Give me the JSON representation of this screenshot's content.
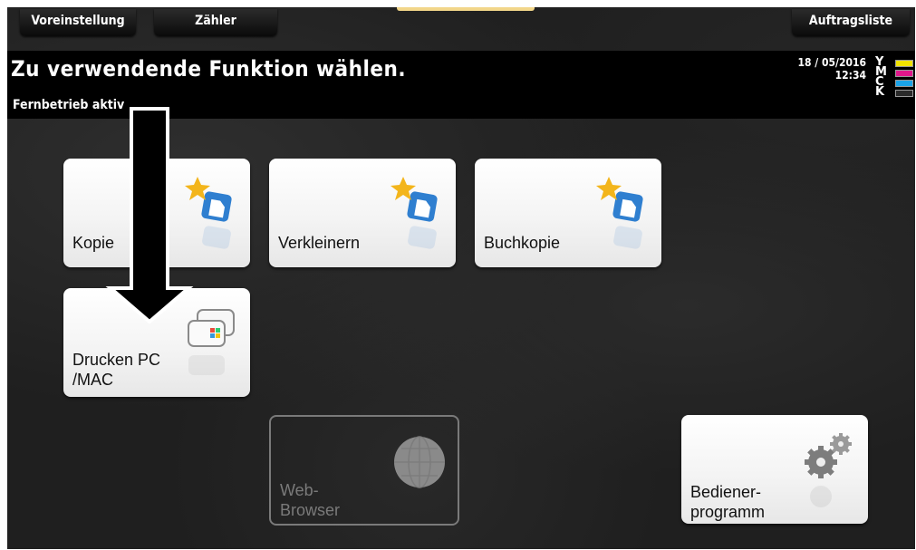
{
  "topbar": {
    "preset_label": "Voreinstellung",
    "counter_label": "Zähler",
    "joblist_label": "Auftragsliste"
  },
  "header": {
    "title": "Zu verwendende Funktion wählen.",
    "status": "Fernbetrieb aktiv",
    "date": "18 / 05/2016",
    "time": "12:34"
  },
  "toner": [
    {
      "letter": "Y",
      "color": "#f1e300"
    },
    {
      "letter": "M",
      "color": "#e0178b"
    },
    {
      "letter": "C",
      "color": "#1aa3e8"
    },
    {
      "letter": "K",
      "color": "#2a2a2a"
    }
  ],
  "tiles": {
    "copy": "Kopie",
    "reduce": "Verkleinern",
    "book_copy": "Buchkopie",
    "print_pc_line1": "Drucken PC",
    "print_pc_line2": "/MAC",
    "web_line1": "Web-",
    "web_line2": "Browser",
    "utility_line1": "Bediener-",
    "utility_line2": "programm"
  },
  "colors": {
    "accent_icon": "#2f7fd0",
    "star": "#f3b51b"
  }
}
